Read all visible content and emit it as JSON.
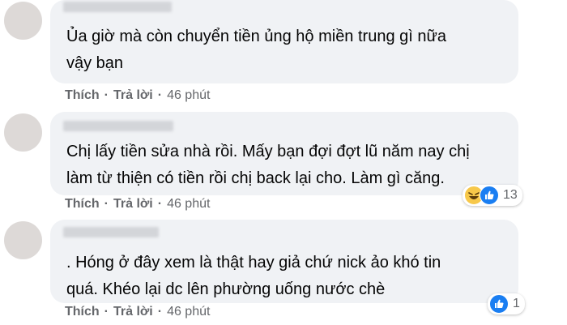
{
  "comments": [
    {
      "text": "Ủa giờ mà còn chuyển tiền ủng hộ miền trung gì nữa\nvậy bạn",
      "like_label": "Thích",
      "reply_label": "Trả lời",
      "separator": "·",
      "time": "46 phút"
    },
    {
      "text": "Chị lấy tiền sửa nhà rồi. Mấy bạn đợi đợt lũ năm nay chị\nlàm từ thiện có tiền rồi chị back lại cho. Làm gì căng.",
      "like_label": "Thích",
      "reply_label": "Trả lời",
      "separator": "·",
      "time": "46 phút",
      "reaction_count": "13",
      "reaction_icons": [
        "haha-icon",
        "like-icon"
      ]
    },
    {
      "text": ". Hóng ở đây xem là thật hay giả chứ nick ảo khó tin\nquá. Khéo lại dc lên phường uống nước chè",
      "like_label": "Thích",
      "reply_label": "Trả lời",
      "separator": "·",
      "time": "46 phút",
      "reaction_count": "1",
      "reaction_icons": [
        "like-icon"
      ]
    }
  ],
  "colors": {
    "bubble": "#f0f2f5",
    "action_text": "#65676b",
    "like_blue": "#1a7ef2",
    "haha_yellow": "#f7c84a"
  }
}
